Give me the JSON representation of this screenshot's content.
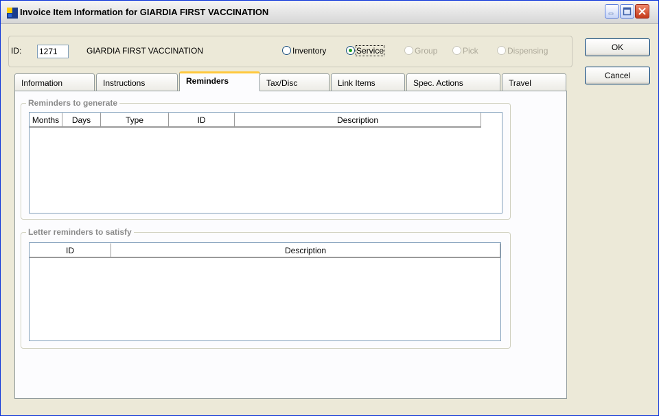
{
  "window": {
    "title": "Invoice Item Information for GIARDIA FIRST VACCINATION",
    "controls": [
      "minimize",
      "maximize",
      "close"
    ]
  },
  "item": {
    "id_label": "ID:",
    "id_value": "1271",
    "name": "GIARDIA FIRST VACCINATION"
  },
  "item_type": {
    "options": [
      {
        "label": "Inventory",
        "checked": false,
        "enabled": true
      },
      {
        "label": "Service",
        "checked": true,
        "enabled": true
      },
      {
        "label": "Group",
        "checked": false,
        "enabled": false
      },
      {
        "label": "Pick",
        "checked": false,
        "enabled": false
      },
      {
        "label": "Dispensing",
        "checked": false,
        "enabled": false
      }
    ]
  },
  "buttons": {
    "ok": "OK",
    "cancel": "Cancel"
  },
  "tabs": [
    {
      "label": "Information"
    },
    {
      "label": "Instructions"
    },
    {
      "label": "Reminders",
      "active": true
    },
    {
      "label": "Tax/Disc"
    },
    {
      "label": "Link Items"
    },
    {
      "label": "Spec. Actions"
    },
    {
      "label": "Travel"
    }
  ],
  "reminders_group": {
    "title": "Reminders to generate",
    "columns": [
      "Months",
      "Days",
      "Type",
      "ID",
      "Description"
    ],
    "rows": []
  },
  "letters_group": {
    "title": "Letter reminders to satisfy",
    "columns": [
      "ID",
      "Description"
    ],
    "rows": []
  },
  "colors": {
    "window_bg": "#ece9d8",
    "active_tab_accent": "#ffc83c",
    "grid_border": "#7f9db9"
  }
}
